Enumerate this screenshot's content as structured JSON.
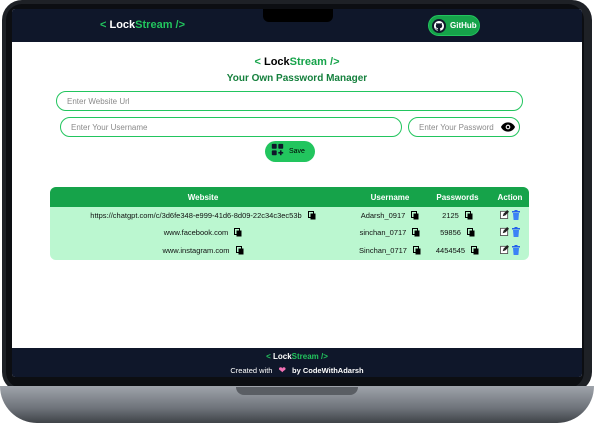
{
  "nav": {
    "logo_left": "< ",
    "logo_lock": "Lock",
    "logo_stream": "Stream",
    "logo_right": " />",
    "github_label": "GitHub"
  },
  "header": {
    "logo_left": "< ",
    "logo_lock": "Lock",
    "logo_stream": "Stream",
    "logo_right": " />",
    "subtitle": "Your Own Password Manager"
  },
  "form": {
    "url_placeholder": "Enter Website Url",
    "username_placeholder": "Enter Your Username",
    "password_placeholder": "Enter Your Password",
    "save_label": "Save"
  },
  "table": {
    "headers": [
      "Website",
      "Username",
      "Passwords",
      "Action"
    ],
    "rows": [
      {
        "website": "https://chatgpt.com/c/3d6fe348-e999-41d6-8d09-22c34c3ec53b",
        "username": "Adarsh_0917",
        "password": "2125"
      },
      {
        "website": "www.facebook.com",
        "username": "sinchan_0717",
        "password": "59856"
      },
      {
        "website": "www.instagram.com",
        "username": "Sinchan_0717",
        "password": "4454545"
      }
    ]
  },
  "footer": {
    "logo_left": "< ",
    "logo_lock": "Lock",
    "logo_stream": "Stream",
    "logo_right": " />",
    "created_with": "Created with",
    "by": "by CodeWithAdarsh"
  },
  "colors": {
    "accent": "#22c55e",
    "nav_bg": "#0f172a",
    "table_header": "#16a34a",
    "table_body": "#bbf7d0"
  },
  "icons": [
    "github-icon",
    "eye-icon",
    "add-icon",
    "copy-icon",
    "edit-icon",
    "delete-icon",
    "heart-icon"
  ]
}
